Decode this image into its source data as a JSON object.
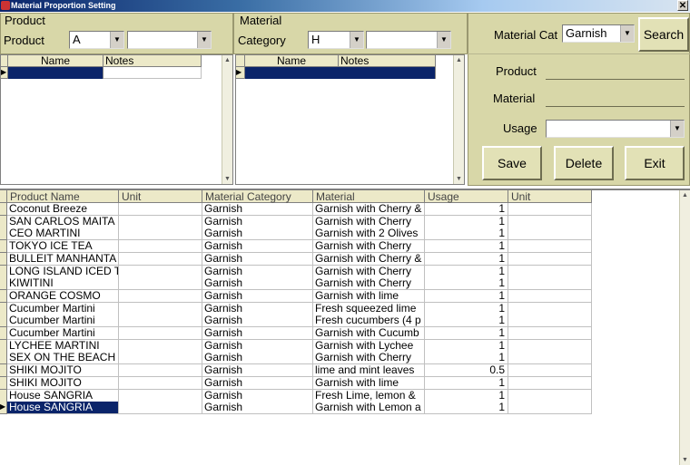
{
  "window": {
    "title": "Material Proportion Setting",
    "close": "✕"
  },
  "product_group": {
    "label": "Product",
    "field_label": "Product",
    "combo1_value": "A",
    "combo2_value": "",
    "grid": {
      "columns": [
        "Name",
        "Notes"
      ]
    }
  },
  "material_group": {
    "label": "Material",
    "field_label": "Category",
    "combo1_value": "H",
    "combo2_value": "",
    "grid": {
      "columns": [
        "Name",
        "Notes"
      ]
    }
  },
  "right_panel": {
    "material_cat_label": "Material Cat",
    "material_cat_value": "Garnish",
    "search_label": "Search",
    "product_label": "Product",
    "material_label": "Material",
    "usage_label": "Usage",
    "usage_value": "",
    "save_label": "Save",
    "delete_label": "Delete",
    "exit_label": "Exit"
  },
  "main_grid": {
    "columns": [
      "Product Name",
      "Unit",
      "Material Category",
      "Material",
      "Usage",
      "Unit"
    ],
    "rows": [
      [
        "Coconut Breeze",
        "",
        "Garnish",
        "Garnish with Cherry &",
        "1",
        ""
      ],
      [
        "SAN CARLOS MAITA",
        "",
        "Garnish",
        "Garnish with Cherry",
        "1",
        ""
      ],
      [
        "CEO MARTINI",
        "",
        "Garnish",
        "Garnish with 2 Olives",
        "1",
        ""
      ],
      [
        "TOKYO ICE TEA",
        "",
        "Garnish",
        "Garnish with Cherry",
        "1",
        ""
      ],
      [
        "BULLEIT MANHANTA",
        "",
        "Garnish",
        "Garnish with Cherry &",
        "1",
        ""
      ],
      [
        "LONG ISLAND ICED T",
        "",
        "Garnish",
        "Garnish with Cherry",
        "1",
        ""
      ],
      [
        "KIWITINI",
        "",
        "Garnish",
        "Garnish with Cherry",
        "1",
        ""
      ],
      [
        "ORANGE COSMO",
        "",
        "Garnish",
        "Garnish with lime",
        "1",
        ""
      ],
      [
        "Cucumber Martini",
        "",
        "Garnish",
        "Fresh squeezed lime",
        "1",
        ""
      ],
      [
        "Cucumber Martini",
        "",
        "Garnish",
        "Fresh cucumbers (4 p",
        "1",
        ""
      ],
      [
        "Cucumber Martini",
        "",
        "Garnish",
        "Garnish with Cucumb",
        "1",
        ""
      ],
      [
        "LYCHEE MARTINI",
        "",
        "Garnish",
        "Garnish with Lychee",
        "1",
        ""
      ],
      [
        "SEX ON THE BEACH",
        "",
        "Garnish",
        "Garnish with Cherry",
        "1",
        ""
      ],
      [
        "SHIKI MOJITO",
        "",
        "Garnish",
        "lime and mint leaves",
        "0.5",
        ""
      ],
      [
        "SHIKI MOJITO",
        "",
        "Garnish",
        "Garnish with lime",
        "1",
        ""
      ],
      [
        "House SANGRIA",
        "",
        "Garnish",
        "Fresh Lime, lemon &",
        "1",
        ""
      ],
      [
        "House SANGRIA",
        "",
        "Garnish",
        "Garnish with Lemon a",
        "1",
        ""
      ]
    ],
    "selected_row": 16
  },
  "icons": {
    "dropdown": "chevron-down-icon",
    "row_pointer": "row-pointer-icon"
  },
  "colors": {
    "panel_bg": "#d8d7a8",
    "selection": "#0a246a"
  }
}
